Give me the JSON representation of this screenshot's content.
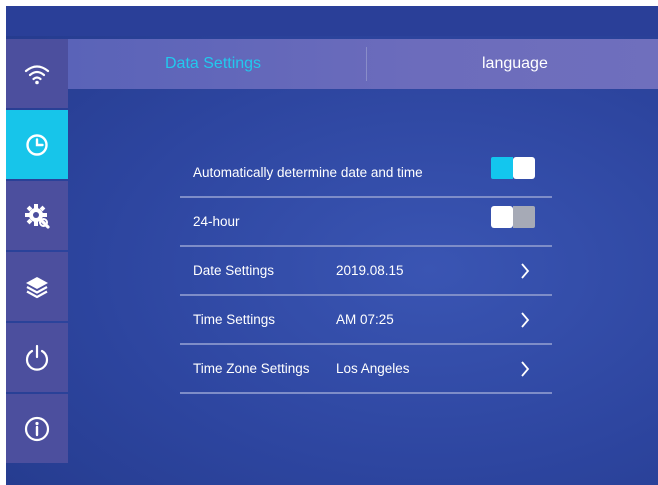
{
  "tabs": {
    "data_settings": "Data Settings",
    "language": "language"
  },
  "sidebar": {
    "items": [
      {
        "icon": "wifi-icon",
        "active": false
      },
      {
        "icon": "clock-icon",
        "active": true
      },
      {
        "icon": "gear-icon",
        "active": false
      },
      {
        "icon": "layers-icon",
        "active": false
      },
      {
        "icon": "power-icon",
        "active": false
      },
      {
        "icon": "info-icon",
        "active": false
      }
    ]
  },
  "settings": {
    "auto_datetime": {
      "label": "Automatically determine date and time",
      "enabled": true
    },
    "hour24": {
      "label": "24-hour",
      "enabled": false
    },
    "date": {
      "label": "Date Settings",
      "value": "2019.08.15"
    },
    "time": {
      "label": "Time Settings",
      "value": "AM 07:25"
    },
    "timezone": {
      "label": "Time Zone Settings",
      "value": "Los Angeles"
    }
  },
  "colors": {
    "accent": "#17c5ea",
    "background": "#2d459f",
    "tabbar": "#6a6aba",
    "sidebar": "#4c4f9e"
  }
}
